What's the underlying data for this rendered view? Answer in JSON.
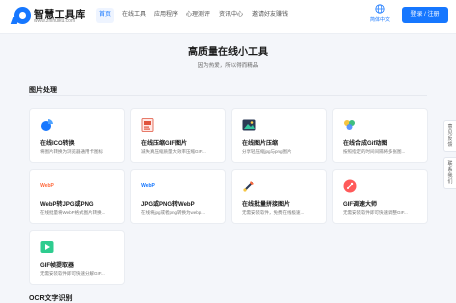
{
  "header": {
    "logo_name": "智慧工具库",
    "logo_url": "www.zhihuiku.com",
    "nav": [
      {
        "label": "首页",
        "active": true
      },
      {
        "label": "在线工具",
        "active": false
      },
      {
        "label": "应用程序",
        "active": false
      },
      {
        "label": "心理测评",
        "active": false
      },
      {
        "label": "资讯中心",
        "active": false
      },
      {
        "label": "邀请好友赚钱",
        "active": false
      }
    ],
    "lang_label": "简体中文",
    "login_label": "登录 / 注册"
  },
  "hero": {
    "title": "高质量在线小工具",
    "subtitle": "因为热爱，所以得而精品"
  },
  "sections": [
    {
      "title": "图片处理",
      "cards": [
        {
          "name": "在线ICO转换",
          "desc": "将图片转换为浏览器通用卡图标",
          "icon": "ico-convert-icon"
        },
        {
          "name": "在线压缩GIF图片",
          "desc": "减失真压缩质量大效率压缩GIF...",
          "icon": "gif-compress-icon"
        },
        {
          "name": "在线图片压缩",
          "desc": "分享轻压缩jpg与png图片",
          "icon": "image-compress-icon"
        },
        {
          "name": "在线合成Gif动图",
          "desc": "按照指定的时间间隔将多张图...",
          "icon": "gif-compose-icon"
        },
        {
          "name": "WebP转JPG或PNG",
          "desc": "在线批量将WebP格式图片转换...",
          "icon": "webp-to-jpg-icon",
          "badge": "WebP"
        },
        {
          "name": "JPG或PNG转WebP",
          "desc": "在线将jpg或者png转换为webp...",
          "icon": "jpg-to-webp-icon",
          "badge": "WebP"
        },
        {
          "name": "在线批量拼接图片",
          "desc": "无需安装软件，免费在线极速...",
          "icon": "image-stitch-icon"
        },
        {
          "name": "GIF调速大师",
          "desc": "无需安装软件即可快速调整GIF...",
          "icon": "gif-speed-icon"
        },
        {
          "name": "GIF帧提取器",
          "desc": "无需安装软件即可快速分解GIF...",
          "icon": "gif-frame-icon"
        }
      ]
    },
    {
      "title": "OCR文字识别"
    }
  ],
  "side_buttons": [
    {
      "label": "意见反馈"
    },
    {
      "label": "联系我们"
    }
  ],
  "colors": {
    "accent": "#1677ff",
    "background": "#f4f6fa",
    "card": "#ffffff"
  }
}
